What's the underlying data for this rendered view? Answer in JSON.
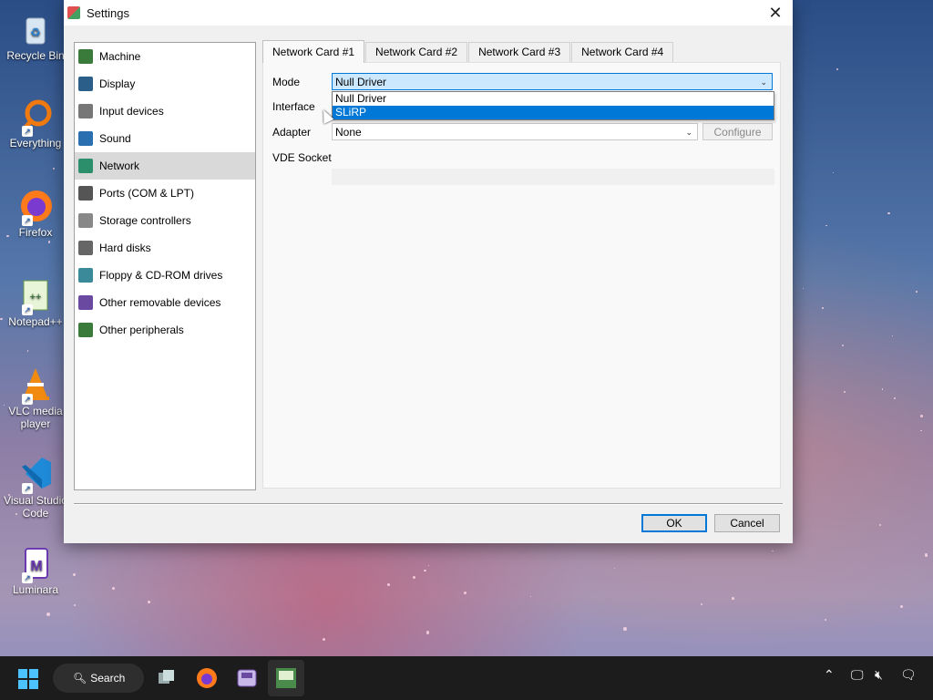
{
  "desktop": {
    "icons": [
      {
        "label": "Recycle Bin",
        "icon": "recycle-bin-icon"
      },
      {
        "label": "Everything",
        "icon": "everything-search-icon"
      },
      {
        "label": "Firefox",
        "icon": "firefox-icon"
      },
      {
        "label": "Notepad++",
        "icon": "notepad-plus-plus-icon"
      },
      {
        "label": "VLC media player",
        "icon": "vlc-icon"
      },
      {
        "label": "Visual Studio Code",
        "icon": "vscode-icon"
      },
      {
        "label": "Luminara",
        "icon": "luminara-icon"
      }
    ]
  },
  "window": {
    "title": "Settings",
    "close_glyph": "✕"
  },
  "sidebar": {
    "items": [
      {
        "label": "Machine",
        "icon": "machine-icon",
        "color": "#3a7a3a"
      },
      {
        "label": "Display",
        "icon": "display-icon",
        "color": "#2b5f8a"
      },
      {
        "label": "Input devices",
        "icon": "input-devices-icon",
        "color": "#777777"
      },
      {
        "label": "Sound",
        "icon": "sound-icon",
        "color": "#2a6fb0"
      },
      {
        "label": "Network",
        "icon": "network-icon",
        "color": "#2a8f6a",
        "selected": true
      },
      {
        "label": "Ports (COM & LPT)",
        "icon": "ports-icon",
        "color": "#555555"
      },
      {
        "label": "Storage controllers",
        "icon": "storage-controllers-icon",
        "color": "#888888"
      },
      {
        "label": "Hard disks",
        "icon": "hard-disk-icon",
        "color": "#666666"
      },
      {
        "label": "Floppy & CD-ROM drives",
        "icon": "floppy-cdrom-icon",
        "color": "#3a8a9a"
      },
      {
        "label": "Other removable devices",
        "icon": "removable-device-icon",
        "color": "#6a4aa0"
      },
      {
        "label": "Other peripherals",
        "icon": "peripherals-icon",
        "color": "#3a7a3a"
      }
    ]
  },
  "tabs": [
    "Network Card #1",
    "Network Card #2",
    "Network Card #3",
    "Network Card #4"
  ],
  "network": {
    "mode_label": "Mode",
    "mode_value": "Null Driver",
    "mode_options": [
      "Null Driver",
      "SLiRP"
    ],
    "interface_label": "Interface",
    "adapter_label": "Adapter",
    "adapter_value": "None",
    "configure_label": "Configure",
    "vde_label": "VDE Socket"
  },
  "footer": {
    "ok_label": "OK",
    "cancel_label": "Cancel"
  },
  "taskbar": {
    "search_label": "Search",
    "accent": "#4cc2ff"
  },
  "colors": {
    "selection": "#0078d7",
    "sidebar_selected": "#d9d9d9"
  }
}
